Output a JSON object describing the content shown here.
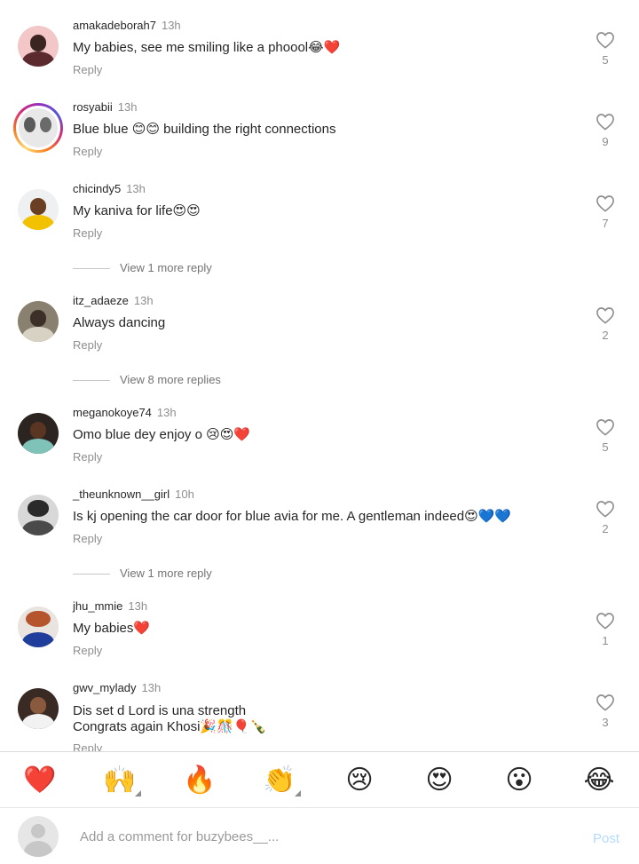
{
  "comments": [
    {
      "username": "amakadeborah7",
      "time": "13h",
      "text": "My babies, see me smiling like a phoool😂❤️",
      "reply": "Reply",
      "likes": "5"
    },
    {
      "username": "rosyabii",
      "time": "13h",
      "text": "Blue blue 😊😊 building the right connections",
      "reply": "Reply",
      "likes": "9"
    },
    {
      "username": "chicindy5",
      "time": "13h",
      "text": "My kaniva for life😍😍",
      "reply": "Reply",
      "likes": "7"
    },
    {
      "username": "itz_adaeze",
      "time": "13h",
      "text": "Always dancing",
      "reply": "Reply",
      "likes": "2"
    },
    {
      "username": "meganokoye74",
      "time": "13h",
      "text": "Omo blue dey enjoy o 😢😍❤️",
      "reply": "Reply",
      "likes": "5"
    },
    {
      "username": "_theunknown__girl",
      "time": "10h",
      "text": "Is kj opening the car door for blue avia for me. A gentleman indeed😍💙💙",
      "reply": "Reply",
      "likes": "2"
    },
    {
      "username": "jhu_mmie",
      "time": "13h",
      "text": "My babies❤️",
      "reply": "Reply",
      "likes": "1"
    },
    {
      "username": "gwv_mylady",
      "time": "13h",
      "text_line1": "Dis set d Lord is una strength",
      "text_line2": "Congrats  again Khosi🎉🎊🎈🍾",
      "reply": "Reply",
      "likes": "3"
    }
  ],
  "view_more": [
    "View 1 more reply",
    "View 8 more replies",
    "View 1 more reply"
  ],
  "emoji_bar": [
    "❤️",
    "🙌",
    "🔥",
    "👏",
    "😢",
    "😍",
    "😮",
    "😂"
  ],
  "composer": {
    "placeholder": "Add a comment for buzybees__...",
    "post_label": "Post"
  },
  "colors": {
    "post_disabled": "#b3dbff",
    "meta_gray": "#8e8e8e"
  }
}
